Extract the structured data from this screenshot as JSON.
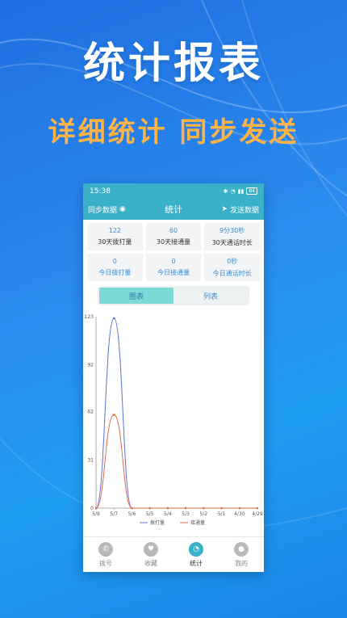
{
  "promo": {
    "title": "统计报表",
    "subtitle": "详细统计 同步发送"
  },
  "colors": {
    "accent": "#3bb0c9",
    "dial_series": "#5b6fd6",
    "connect_series": "#e06a4a",
    "promo_subtitle": "#ffb347"
  },
  "statusbar": {
    "time": "15:38",
    "battery": "84"
  },
  "appbar": {
    "sync_label": "同步数据",
    "title": "统计",
    "send_label": "发送数据"
  },
  "stats": [
    {
      "value": "122",
      "label": "30天拨打量"
    },
    {
      "value": "60",
      "label": "30天接通量"
    },
    {
      "value": "9分30秒",
      "label": "30天通话时长"
    },
    {
      "value": "0",
      "label": "今日拨打量"
    },
    {
      "value": "0",
      "label": "今日接通量"
    },
    {
      "value": "0秒",
      "label": "今日通话时长"
    }
  ],
  "segment": {
    "chart_label": "图表",
    "list_label": "列表"
  },
  "chart_data": {
    "type": "line",
    "x": [
      "5/8",
      "5/7",
      "5/6",
      "5/5",
      "5/4",
      "5/3",
      "5/2",
      "5/1",
      "4/30",
      "4/29"
    ],
    "series": [
      {
        "name": "拨打量",
        "values": [
          0,
          122,
          0,
          0,
          0,
          0,
          0,
          0,
          0,
          0
        ]
      },
      {
        "name": "接通量",
        "values": [
          0,
          60,
          0,
          0,
          0,
          0,
          0,
          0,
          0,
          0
        ]
      }
    ],
    "yticks": [
      "0",
      "31",
      "62",
      "92",
      "123"
    ],
    "ylim": [
      0,
      123
    ],
    "legend_position": "bottom"
  },
  "tabs": [
    {
      "label": "拨号",
      "icon": "phone-icon"
    },
    {
      "label": "收藏",
      "icon": "heart-icon"
    },
    {
      "label": "统计",
      "icon": "pie-chart-icon"
    },
    {
      "label": "我的",
      "icon": "user-icon"
    }
  ]
}
